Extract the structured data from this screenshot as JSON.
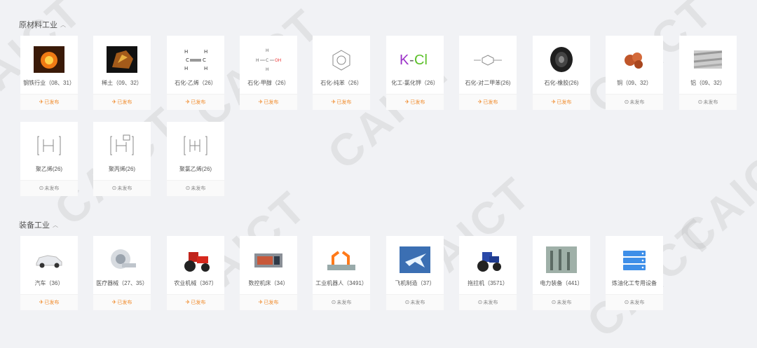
{
  "sections": [
    {
      "title": "原材料工业",
      "cards": [
        {
          "label": "钢铁行业（08、31）",
          "status": "已发布",
          "published": true,
          "icon": "steel-furnace-icon"
        },
        {
          "label": "稀土（09、32）",
          "status": "已发布",
          "published": true,
          "icon": "rare-earth-ore-icon"
        },
        {
          "label": "石化-乙烯（26）",
          "status": "已发布",
          "published": true,
          "icon": "ethylene-formula-icon"
        },
        {
          "label": "石化-甲醇（26）",
          "status": "已发布",
          "published": true,
          "icon": "methanol-formula-icon"
        },
        {
          "label": "石化-纯苯（26）",
          "status": "已发布",
          "published": true,
          "icon": "benzene-ring-icon"
        },
        {
          "label": "化工-氯化钾（26）",
          "status": "已发布",
          "published": true,
          "icon": "kcl-icon"
        },
        {
          "label": "石化-对二甲苯(26)",
          "status": "已发布",
          "published": true,
          "icon": "paraxylene-formula-icon"
        },
        {
          "label": "石化-橡胶(26)",
          "status": "已发布",
          "published": true,
          "icon": "tire-icon"
        },
        {
          "label": "铜（09、32）",
          "status": "未发布",
          "published": false,
          "icon": "copper-icon"
        },
        {
          "label": "铝（09、32）",
          "status": "未发布",
          "published": false,
          "icon": "aluminum-bars-icon"
        },
        {
          "label": "聚乙烯(26)",
          "status": "未发布",
          "published": false,
          "icon": "polyethylene-formula-icon"
        },
        {
          "label": "聚丙烯(26)",
          "status": "未发布",
          "published": false,
          "icon": "polypropylene-formula-icon"
        },
        {
          "label": "聚氯乙烯(26)",
          "status": "未发布",
          "published": false,
          "icon": "pvc-formula-icon"
        }
      ]
    },
    {
      "title": "装备工业",
      "cards": [
        {
          "label": "汽车（36）",
          "status": "已发布",
          "published": true,
          "icon": "car-icon"
        },
        {
          "label": "医疗器械（27、35）",
          "status": "已发布",
          "published": true,
          "icon": "ct-scanner-icon"
        },
        {
          "label": "农业机械（367）",
          "status": "已发布",
          "published": true,
          "icon": "tractor-icon"
        },
        {
          "label": "数控机床（34）",
          "status": "已发布",
          "published": true,
          "icon": "cnc-machine-icon"
        },
        {
          "label": "工业机器人（3491）",
          "status": "未发布",
          "published": false,
          "icon": "robot-arm-icon"
        },
        {
          "label": "飞机制造（37）",
          "status": "未发布",
          "published": false,
          "icon": "airplane-icon"
        },
        {
          "label": "拖拉机（3571）",
          "status": "未发布",
          "published": false,
          "icon": "blue-tractor-icon"
        },
        {
          "label": "电力装备（441）",
          "status": "未发布",
          "published": false,
          "icon": "power-equipment-icon"
        },
        {
          "label": "炼油化工专用设备",
          "status": "未发布",
          "published": false,
          "icon": "server-stack-icon"
        }
      ]
    }
  ],
  "watermark": "CAICT"
}
